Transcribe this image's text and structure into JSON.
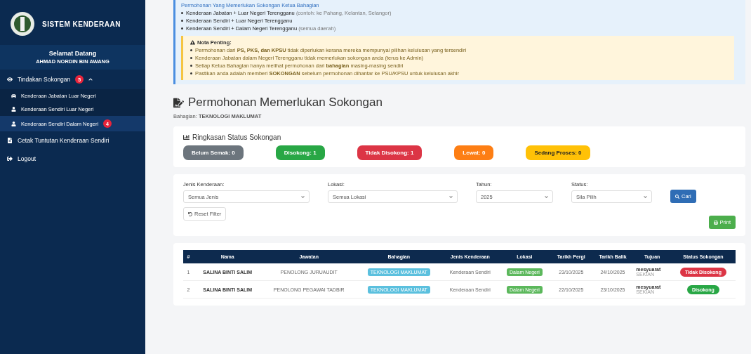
{
  "sidebar": {
    "title": "SISTEM KENDERAAN",
    "welcome": "Selamat Datang",
    "user": "AHMAD NORDIN BIN AWANG",
    "menu": [
      {
        "label": "Tindakan Sokongan",
        "badge": "5",
        "expanded": true,
        "children": [
          {
            "label": "Kenderaan Jabatan Luar Negeri",
            "selected": false
          },
          {
            "label": "Kenderaan Sendiri Luar Negeri",
            "selected": false
          },
          {
            "label": "Kenderaan Sendiri Dalam Negeri",
            "badge": "4",
            "selected": true
          }
        ]
      },
      {
        "label": "Cetak Tuntutan Kenderaan Sendiri"
      },
      {
        "label": "Logout"
      }
    ]
  },
  "info": {
    "heading": "Permohonan Yang Memerlukan Sokongan Ketua Bahagian",
    "items": [
      {
        "main": "Kenderaan Jabatan + Luar Negeri Terengganu",
        "note": "(contoh: ke Pahang, Kelantan, Selangor)"
      },
      {
        "main": "Kenderaan Sendiri + Luar Negeri Terengganu"
      },
      {
        "main": "Kenderaan Sendiri + Dalam Negeri Terengganu",
        "note": "(semua daerah)"
      }
    ],
    "warning_title": "Nota Penting:",
    "warnings": [
      "Permohonan dari **PS, PKS, dan KPSU** tidak diperlukan kerana mereka mempunyai pilihan kelulusan yang tersendiri",
      "Kenderaan Jabatan dalam Negeri Terengganu tidak memerlukan sokongan anda (terus ke Admin)",
      "Setiap Ketua Bahagian hanya melihat permohonan dari **bahagian** masing-masing sendiri",
      "Pastikan anda adalah memberi **SOKONGAN** sebelum permohonan dihantar ke PSU/KPSU untuk kelulusan akhir"
    ]
  },
  "page": {
    "title": "Permohonan Memerlukan Sokongan",
    "dept_label": "Bahagian:",
    "dept": "TEKNOLOGI MAKLUMAT"
  },
  "summary": {
    "title": "Ringkasan Status Sokongan",
    "badges": [
      {
        "label": "Belum Semak: 0",
        "color": "#6c757d"
      },
      {
        "label": "Disokong: 1",
        "color": "#28a745"
      },
      {
        "label": "Tidak Disokong: 1",
        "color": "#dc3545"
      },
      {
        "label": "Lewat: 0",
        "color": "#fd7e14"
      },
      {
        "label": "Sedang Proses: 0",
        "color": "#ffc107"
      }
    ]
  },
  "filters": {
    "fields": [
      {
        "label": "Jenis Kenderaan:",
        "value": "Semua Jenis"
      },
      {
        "label": "Lokasi:",
        "value": "Semua Lokasi"
      },
      {
        "label": "Tahun:",
        "value": "2025"
      },
      {
        "label": "Status:",
        "value": "Sila Pilih"
      }
    ],
    "search_button": "Cari",
    "reset_button": "Reset Filter",
    "print_button": "Print"
  },
  "table": {
    "columns": [
      "#",
      "Nama",
      "Jawatan",
      "Bahagian",
      "Jenis Kenderaan",
      "Lokasi",
      "Tarikh Pergi",
      "Tarikh Balik",
      "Tujuan",
      "Status Sokongan"
    ],
    "rows": [
      {
        "no": "1",
        "nama": "SALINA BINTI SALIM",
        "jawatan": "PENOLONG JURUAUDIT",
        "bahagian": "TEKNOLOGI MAKLUMAT",
        "jenis": "Kenderaan Sendiri",
        "lokasi": "Dalam Negeri",
        "pergi": "23/10/2025",
        "balik": "24/10/2025",
        "tujuan": "mesyuarat",
        "tujuan_sub": "SEKIAN",
        "status": "Tidak Disokong",
        "kind": "rejected"
      },
      {
        "no": "2",
        "nama": "SALINA BINTI SALIM",
        "jawatan": "PENOLONG PEGAWAI TADBIR",
        "bahagian": "TEKNOLOGI MAKLUMAT",
        "jenis": "Kenderaan Sendiri",
        "lokasi": "Dalam Negeri",
        "pergi": "22/10/2025",
        "balik": "23/10/2025",
        "tujuan": "mesyuarat",
        "tujuan_sub": "SEKIAN",
        "status": "Disokong",
        "kind": "approved"
      }
    ]
  }
}
